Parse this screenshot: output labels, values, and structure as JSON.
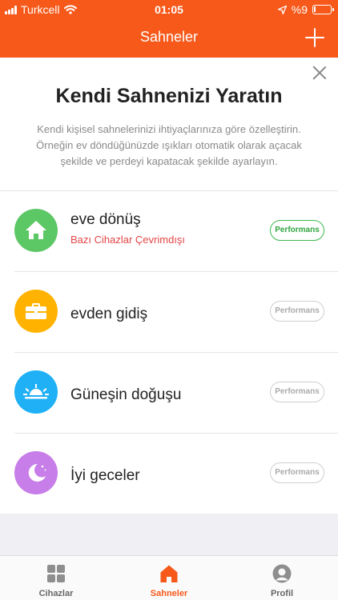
{
  "status_bar": {
    "carrier": "Turkcell",
    "time": "01:05",
    "battery": "%9",
    "battery_level": 0.09
  },
  "nav": {
    "title": "Sahneler",
    "add_icon": "plus-icon"
  },
  "intro": {
    "heading": "Kendi Sahnenizi Yaratın",
    "description_lines": [
      "Kendi kişisel sahnelerinizi ihtiyaçlarınıza göre özelleştirin.",
      "Örneğin ev döndüğünüzde ışıkları otomatik olarak açacak",
      "şekilde ve perdeyi kapatacak şekilde ayarlayın."
    ],
    "close_icon": "close-icon"
  },
  "scenes": [
    {
      "name": "eve dönüş",
      "status": "Bazı Cihazlar Çevrimdışı",
      "button": "Performans",
      "icon": "home-icon",
      "color": "#5cc765",
      "button_active": true
    },
    {
      "name": "evden gidiş",
      "status": "",
      "button": "Performans",
      "icon": "briefcase-icon",
      "color": "#ffb300",
      "button_active": false
    },
    {
      "name": "Güneşin doğuşu",
      "status": "",
      "button": "Performans",
      "icon": "sunrise-icon",
      "color": "#1fb0f5",
      "button_active": false
    },
    {
      "name": "İyi geceler",
      "status": "",
      "button": "Performans",
      "icon": "moon-icon",
      "color": "#c77ee8",
      "button_active": false
    }
  ],
  "tabs": [
    {
      "label": "Cihazlar",
      "icon": "grid-icon",
      "active": false
    },
    {
      "label": "Sahneler",
      "icon": "home-icon",
      "active": true
    },
    {
      "label": "Profil",
      "icon": "profile-icon",
      "active": false
    }
  ],
  "colors": {
    "accent": "#f6591a",
    "offline_status": "#e54545",
    "active_button": "#3cba4e"
  }
}
